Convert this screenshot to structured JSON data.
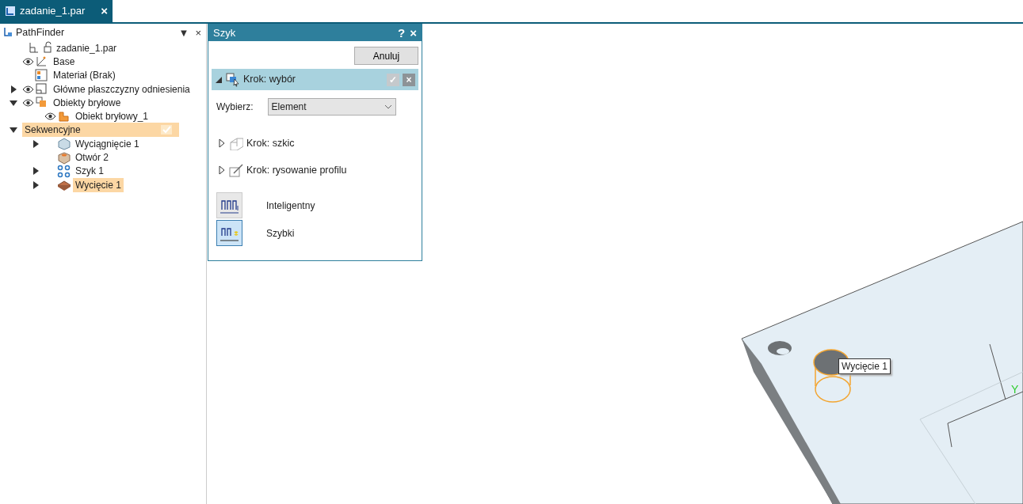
{
  "document_tab": {
    "title": "zadanie_1.par",
    "close": "×",
    "selected": true
  },
  "pathfinder": {
    "title": "PathFinder",
    "menu": "▼",
    "close": "×",
    "tree": [
      {
        "label": "zadanie_1.par",
        "kind": "part",
        "selected": false,
        "children": [
          {
            "label": "Base",
            "kind": "axes",
            "visible": true,
            "selected": false
          },
          {
            "label": "Materiał (Brak)",
            "kind": "material",
            "selected": false
          },
          {
            "label": "Główne płaszczyzny odniesienia",
            "kind": "planes",
            "visible": true,
            "expanded": false,
            "selected": false
          },
          {
            "label": "Obiekty bryłowe",
            "kind": "bodies",
            "visible": true,
            "expanded": true,
            "selected": false,
            "children": [
              {
                "label": "Obiekt bryłowy_1",
                "kind": "body",
                "visible": true,
                "selected": false
              }
            ]
          },
          {
            "label": "Sekwencyjne",
            "kind": "section",
            "expanded": true,
            "selected": true,
            "children": [
              {
                "label": "Wyciągnięcie 1",
                "kind": "extrude",
                "expanded": false,
                "selected": false
              },
              {
                "label": "Otwór 2",
                "kind": "hole",
                "selected": false
              },
              {
                "label": "Szyk 1",
                "kind": "pattern",
                "expanded": false,
                "selected": false
              },
              {
                "label": "Wycięcie 1",
                "kind": "cut",
                "expanded": false,
                "selected": true
              }
            ]
          }
        ]
      }
    ]
  },
  "dialog": {
    "title": "Szyk",
    "help": "?",
    "close": "×",
    "cancel": "Anuluj",
    "steps": [
      {
        "label": "Krok: wybór",
        "kind": "select",
        "expanded": true,
        "accept": "✓",
        "dismiss": "×",
        "field_label": "Wybierz:",
        "field_value": "Element"
      },
      {
        "label": "Krok: szkic",
        "kind": "sketch",
        "expanded": false
      },
      {
        "label": "Krok: rysowanie profilu",
        "kind": "profile",
        "expanded": false
      }
    ],
    "modes": [
      {
        "label": "Inteligentny",
        "selected": false
      },
      {
        "label": "Szybki",
        "selected": true
      }
    ]
  },
  "viewport": {
    "tooltip": "Wycięcie 1",
    "axis_label": "Y"
  }
}
